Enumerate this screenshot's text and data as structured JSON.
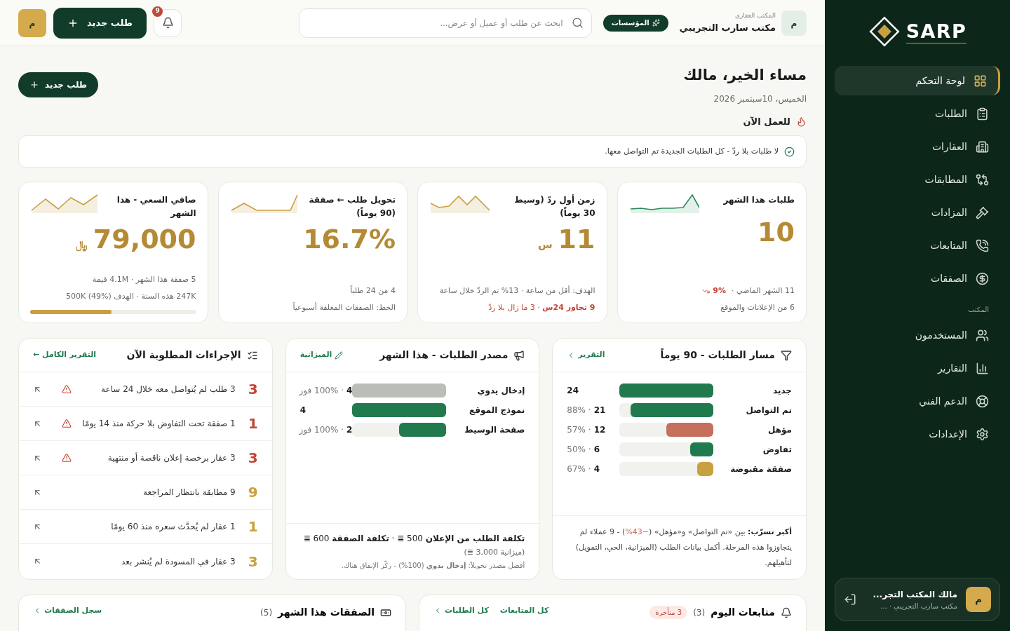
{
  "sidebar": {
    "logo": "SARP",
    "items": [
      {
        "label": "لوحة التحكم",
        "selected": true
      },
      {
        "label": "الطلبات",
        "selected": false
      },
      {
        "label": "العقارات",
        "selected": false
      },
      {
        "label": "المطابقات",
        "selected": false
      },
      {
        "label": "المزادات",
        "selected": false
      },
      {
        "label": "المتابعات",
        "selected": false
      },
      {
        "label": "الصفقات",
        "selected": false
      }
    ],
    "section_label": "المكتب",
    "office_items": [
      {
        "label": "المستخدمون",
        "selected": false
      },
      {
        "label": "التقارير",
        "selected": false
      },
      {
        "label": "الدعم الفني",
        "selected": false
      },
      {
        "label": "الإعدادات",
        "selected": false
      }
    ],
    "user": {
      "avatar": "م",
      "name": "مالك المكتب التجر...",
      "subtitle": "مكتب سارب التجريبي · ..."
    }
  },
  "topbar": {
    "office": {
      "avatar": "م",
      "caption": "المكتب العقاري",
      "name": "مكتب سارب التجريبي",
      "plan": "المؤسسات"
    },
    "search": {
      "placeholder": "ابحث عن طلب أو عميل أو عرض..."
    },
    "notifications": "9",
    "new_button": "طلب جديد",
    "avatar": "م"
  },
  "greeting": {
    "title": "مساء الخير، مالك",
    "date": "الخميس، 10سبتمبر 2026",
    "new_button": "طلب جديد"
  },
  "work_now": {
    "title": "للعمل الآن",
    "notice": "لا طلبات بلا ردّ - كل الطلبات الجديدة تم التواصل معها."
  },
  "kpis": [
    {
      "title": "طلبات هذا الشهر",
      "value": "10",
      "lines": [
        {
          "text": "11 الشهر الماضي ·",
          "delta": "9%"
        },
        {
          "text": "6 من الإعلانات والموقع"
        }
      ]
    },
    {
      "title": "زمن أول ردّ (وسيط 30 يوماً)",
      "value": "11",
      "unit": "س",
      "lines": [
        {
          "text": "الهدف: أقل من ساعة · 13% تم الردّ خلال ساعة"
        },
        {
          "text": "**9 تجاوز 24س** · 3 ما زال بلا ردّ",
          "alert": true
        }
      ]
    },
    {
      "title": "تحويل طلب ← صفقة (90 يوماً)",
      "value": "16.7%",
      "lines": [
        {
          "text": "4 من 24 طلباً"
        },
        {
          "text": "الخط: الصفقات المغلقة أسبوعياً"
        }
      ]
    },
    {
      "title": "صافي السعي - هذا الشهر",
      "value": "79,000",
      "unit": "﷼",
      "lines": [
        {
          "text": "5 صفقة هذا الشهر · 4.1M قيمة"
        },
        {
          "text": "247K هذه السنة · الهدف 500K (49%)"
        }
      ],
      "level": 0.49
    }
  ],
  "funnel": {
    "title": "مسار الطلبات - 90 يوماً",
    "link": "التقرير",
    "rows": [
      {
        "label": "جديد",
        "level": 1,
        "color": "#217a4e",
        "count": "24"
      },
      {
        "label": "تم التواصل",
        "level": 0.88,
        "color": "#217a4e",
        "count": "21",
        "pct": "· 88%"
      },
      {
        "label": "مؤهل",
        "level": 0.5,
        "color": "#c4705c",
        "count": "12",
        "pct": "· 57%"
      },
      {
        "label": "تفاوض",
        "level": 0.25,
        "color": "#217a4e",
        "count": "6",
        "pct": "· 50%"
      },
      {
        "label": "صفقة مقبوضة",
        "level": 0.17,
        "color": "#c9a040",
        "count": "4",
        "pct": "· 67%"
      }
    ],
    "footer": {
      "label": "أكبر تسرّب:",
      "before": "بين «تم التواصل» و«مؤهل» (",
      "highlight": "−43%",
      "after": ") - 9 عملاء لم يتجاوزوا هذه المرحلة. أكمل بيانات الطلب (الميزانية، الحي، التمويل) لتأهيلهم."
    }
  },
  "sources": {
    "title": "مصدر الطلبات - هذا الشهر",
    "link": "الميزانية",
    "rows": [
      {
        "label": "إدخال يدوي",
        "level": 1,
        "color": "#b9beb6",
        "count": "4",
        "note": "· 100% فوز"
      },
      {
        "label": "نموذج الموقع",
        "level": 1,
        "color": "#217a4e",
        "count": "4"
      },
      {
        "label": "صفحة الوسيط",
        "level": 0.5,
        "color": "#217a4e",
        "count": "2",
        "note": "· 100% فوز"
      }
    ],
    "cost": "**تكلفة الطلب من الإعلان** 500 ≣ · **تكلفة الصفقة** 600 ≣",
    "budget": "(ميزانية 3,000 ≣)",
    "best": "أفضل مصدر تحويلاً: **إدخال يدوي** (100%) - ركّز الإنفاق هناك."
  },
  "actions": {
    "title": "الإجراءات المطلوبة الآن",
    "link": "التقرير الكامل ←",
    "items": [
      {
        "count": "3",
        "text": "3 طلب لم يُتواصل معه خلال 24 ساعة",
        "urgent": true
      },
      {
        "count": "1",
        "text": "1 صفقة تحت التفاوض بلا حركة منذ 14 يومًا",
        "urgent": true
      },
      {
        "count": "3",
        "text": "3 عقار برخصة إعلان ناقصة أو منتهية",
        "urgent": true
      },
      {
        "count": "9",
        "text": "9 مطابقة بانتظار المراجعة",
        "urgent": false
      },
      {
        "count": "1",
        "text": "1 عقار لم يُحدَّث سعره منذ 60 يومًا",
        "urgent": false
      },
      {
        "count": "3",
        "text": "3 عقار في المسودة لم يُنشر بعد",
        "urgent": false
      }
    ]
  },
  "followups": {
    "title": "متابعات اليوم",
    "count": "(3)",
    "badge": "3 متأخرة",
    "links": [
      "كل المتابعات",
      "كل الطلبات"
    ]
  },
  "deals": {
    "title": "الصفقات هذا الشهر",
    "count": "(5)",
    "link": "سجل الصفقات"
  }
}
